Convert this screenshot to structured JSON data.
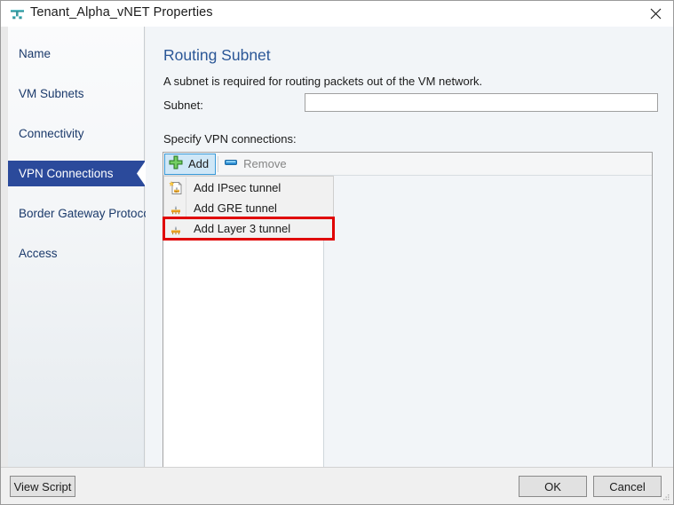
{
  "window": {
    "title": "Tenant_Alpha_vNET Properties",
    "icon": "vnet-icon",
    "close_label": "✕"
  },
  "sidebar": {
    "items": [
      {
        "label": "Name",
        "selected": false
      },
      {
        "label": "VM Subnets",
        "selected": false
      },
      {
        "label": "Connectivity",
        "selected": false
      },
      {
        "label": "VPN Connections",
        "selected": true
      },
      {
        "label": "Border Gateway Protocol...",
        "selected": false
      },
      {
        "label": "Access",
        "selected": false
      }
    ]
  },
  "main": {
    "title": "Routing Subnet",
    "description": "A subnet is required for routing packets out of the VM network.",
    "subnet_label": "Subnet:",
    "subnet_value": "",
    "subnet_placeholder": "",
    "list_label": "Specify VPN connections:"
  },
  "toolbar": {
    "add_label": "Add",
    "add_icon": "green-plus-icon",
    "remove_label": "Remove",
    "remove_icon": "blue-minus-icon",
    "remove_disabled": true
  },
  "menu": {
    "items": [
      {
        "label": "Add IPsec tunnel",
        "icon": "new-tunnel-icon",
        "highlighted": false
      },
      {
        "label": "Add GRE tunnel",
        "icon": "gateway-icon",
        "highlighted": false
      },
      {
        "label": "Add Layer 3 tunnel",
        "icon": "gateway-icon",
        "highlighted": true
      }
    ]
  },
  "footer": {
    "view_script_label": "View Script",
    "ok_label": "OK",
    "cancel_label": "Cancel"
  },
  "colors": {
    "accent_blue": "#2b5797",
    "selection_blue": "#2b4a9b",
    "highlight_red": "#e00000",
    "add_green": "#4cb04c",
    "remove_blue": "#2f8fd4"
  }
}
